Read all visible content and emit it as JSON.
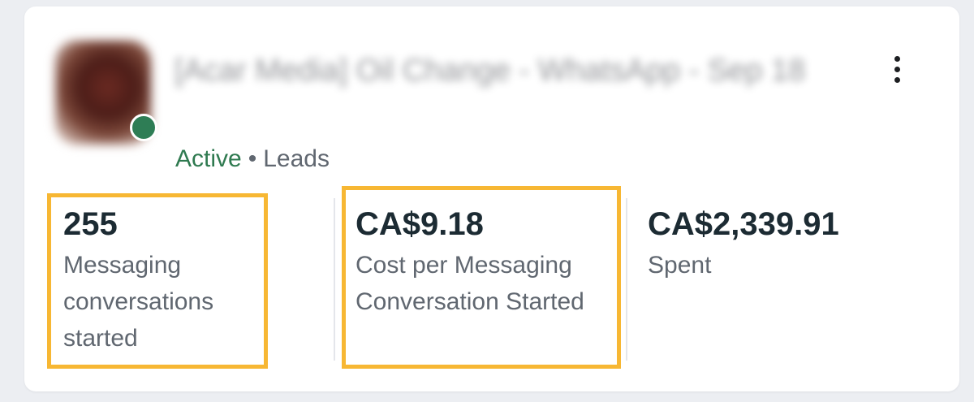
{
  "ad": {
    "title": "[Acar Media] Oil Change - WhatsApp - Sep 18",
    "status": "Active",
    "separator": "•",
    "objective": "Leads"
  },
  "metrics": [
    {
      "value": "255",
      "label": "Messaging conversations started"
    },
    {
      "value": "CA$9.18",
      "label": "Cost per Messaging Conversation Started"
    },
    {
      "value": "CA$2,339.91",
      "label": "Spent"
    }
  ],
  "colors": {
    "active": "#2f7a50",
    "highlight": "#f7b733",
    "value_text": "#1c2b33",
    "label_text": "#606770"
  },
  "icons": {
    "more": "more-vertical-icon",
    "status": "status-dot-icon"
  }
}
